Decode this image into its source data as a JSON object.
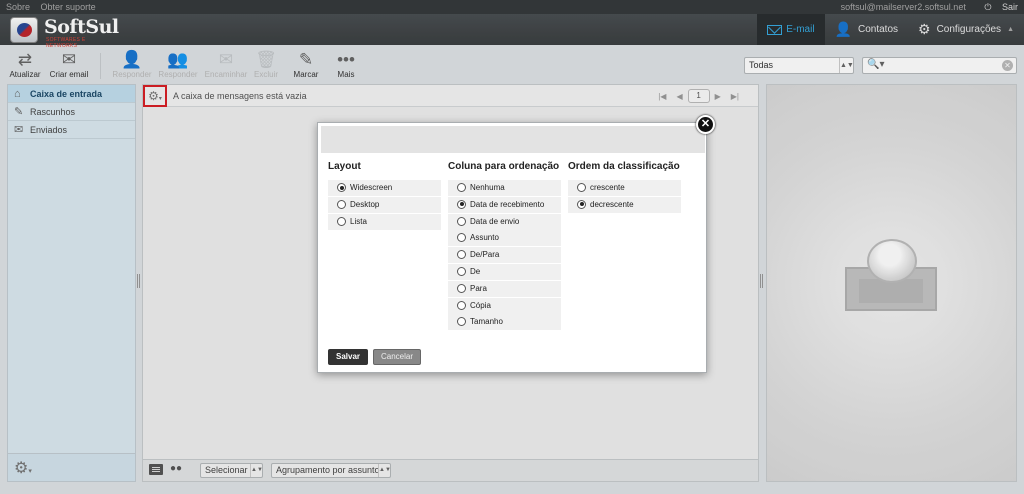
{
  "topbar": {
    "links": [
      "Sobre",
      "Obter suporte"
    ],
    "user": "softsul@mailserver2.softsul.net",
    "logout": "Sair"
  },
  "logo": {
    "name": "SoftSul",
    "tagline": "SOFTWARES E NETWORKS"
  },
  "taskbar": [
    {
      "label": "E-mail",
      "icon": "envelope-icon",
      "active": true
    },
    {
      "label": "Contatos",
      "icon": "person-icon"
    },
    {
      "label": "Configurações",
      "icon": "gear-icon"
    }
  ],
  "toolbar": {
    "refresh": "Atualizar",
    "compose": "Criar email",
    "reply": "Responder",
    "reply_all": "Responder",
    "forward": "Encaminhar",
    "delete": "Excluir",
    "mark": "Marcar",
    "more": "Mais"
  },
  "filter": {
    "selected": "Todas"
  },
  "search": {
    "value": ""
  },
  "folders": [
    {
      "label": "Caixa de entrada",
      "icon": "inbox-icon",
      "selected": true
    },
    {
      "label": "Rascunhos",
      "icon": "pencil-icon"
    },
    {
      "label": "Enviados",
      "icon": "sent-icon"
    }
  ],
  "messagelist": {
    "empty_text": "A caixa de mensagens está vazia",
    "page": "1",
    "select_label": "Selecionar",
    "threading_label": "Agrupamento por assunto"
  },
  "dialog": {
    "layout_title": "Layout",
    "layout_options": [
      {
        "label": "Widescreen",
        "checked": true
      },
      {
        "label": "Desktop",
        "checked": false
      },
      {
        "label": "Lista",
        "checked": false
      }
    ],
    "sort_col_title": "Coluna para ordenação",
    "sort_col_options": [
      {
        "label": "Nenhuma",
        "checked": false
      },
      {
        "label": "Data de recebimento",
        "checked": true
      },
      {
        "label": "Data de envio",
        "checked": false
      },
      {
        "label": "Assunto",
        "checked": false
      },
      {
        "label": "De/Para",
        "checked": false
      },
      {
        "label": "De",
        "checked": false
      },
      {
        "label": "Para",
        "checked": false
      },
      {
        "label": "Cópia",
        "checked": false
      },
      {
        "label": "Tamanho",
        "checked": false
      }
    ],
    "sort_order_title": "Ordem da classificação",
    "sort_order_options": [
      {
        "label": "crescente",
        "checked": false
      },
      {
        "label": "decrescente",
        "checked": true
      }
    ],
    "save": "Salvar",
    "cancel": "Cancelar"
  }
}
